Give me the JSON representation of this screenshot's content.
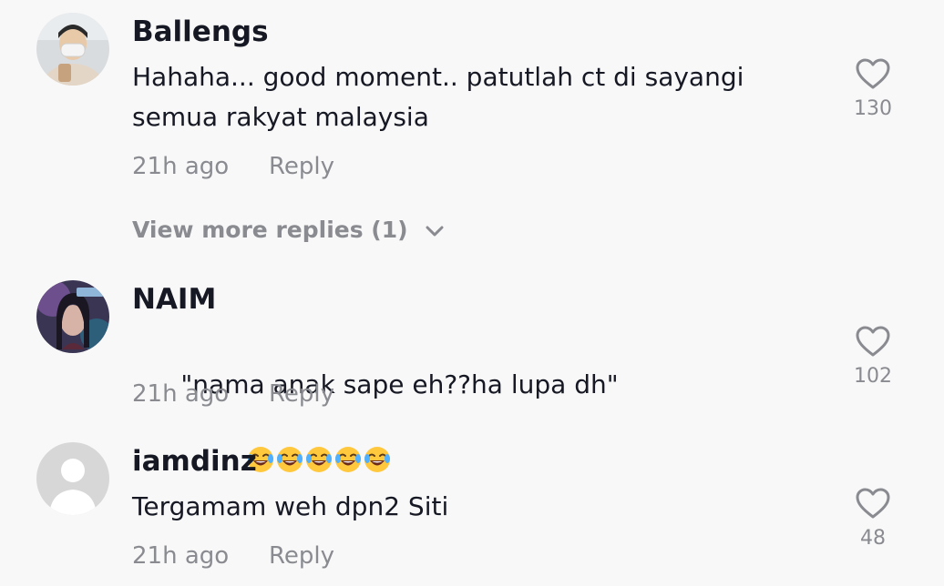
{
  "comments": [
    {
      "username": "Ballengs",
      "text": "Hahaha... good moment.. patutlah ct di sayangi\nsemua rakyat malaysia",
      "time": "21h ago",
      "reply_label": "Reply",
      "likes": "130"
    },
    {
      "username": "NAIM",
      "text": "\"nama anak sape eh??ha lupa dh\"",
      "emoji": "😂😂😂😂😂",
      "time": "21h ago",
      "reply_label": "Reply",
      "likes": "102"
    },
    {
      "username": "iamdinz",
      "text": "Tergamam weh dpn2 Siti",
      "time": "21h ago",
      "reply_label": "Reply",
      "likes": "48"
    }
  ],
  "view_more": {
    "label": "View more replies (1)"
  },
  "icons": {
    "like": "heart-outline-icon",
    "expand": "chevron-down-icon",
    "emoji": "face-with-tears-of-joy"
  },
  "colors": {
    "background": "#f8f8f8",
    "primary_text": "#161823",
    "secondary_text": "#8a8b91"
  }
}
